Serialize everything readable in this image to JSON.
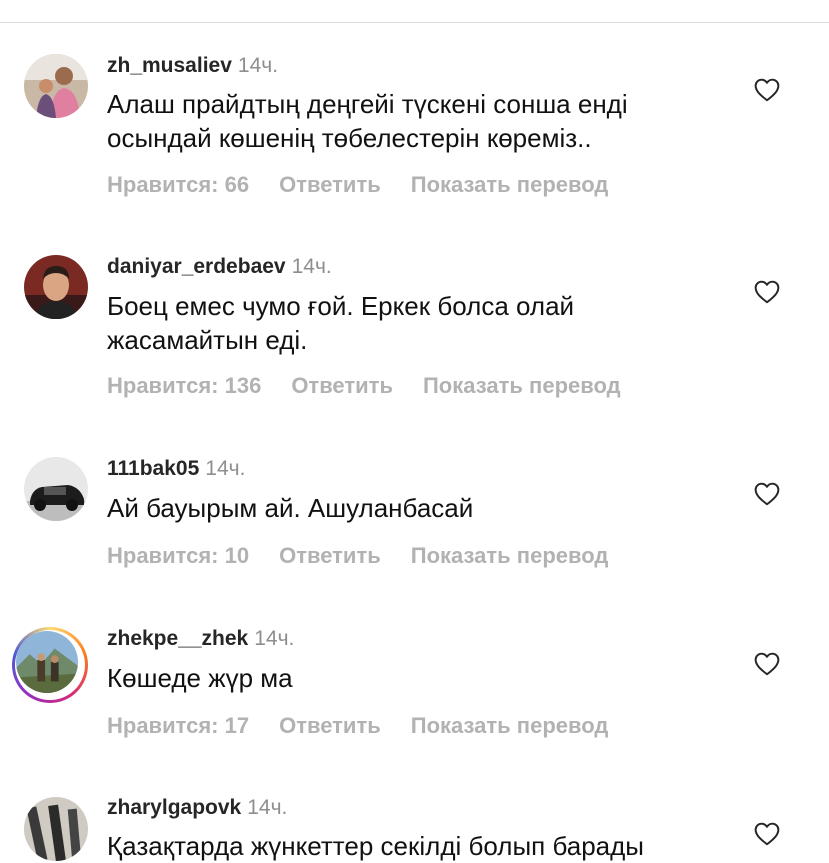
{
  "comments": [
    {
      "username": "zh_musaliev",
      "time": "14ч.",
      "text": "Алаш прайдтың деңгейі түскені сонша енді осындай көшенің төбелестерін көреміз..",
      "likes": "Нравится: 66",
      "reply": "Ответить",
      "translate": "Показать перевод",
      "avatar": "person-with-child-photo"
    },
    {
      "username": "daniyar_erdebaev",
      "time": "14ч.",
      "text": "Боец емес чумо ғой.  Еркек болса олай жасамайтын еді.",
      "likes": "Нравится: 136",
      "reply": "Ответить",
      "translate": "Показать перевод",
      "avatar": "man-portrait-photo"
    },
    {
      "username": "111bak05",
      "time": "14ч.",
      "text": "Ай бауырым ай. Ашуланбасай",
      "likes": "Нравится: 10",
      "reply": "Ответить",
      "translate": "Показать перевод",
      "avatar": "black-car-photo"
    },
    {
      "username": "zhekpe__zhek",
      "time": "14ч.",
      "text": "Көшеде жүр ма",
      "likes": "Нравится: 17",
      "reply": "Ответить",
      "translate": "Показать перевод",
      "avatar": "mountain-people-photo"
    },
    {
      "username": "zharylgapovk",
      "time": "14ч.",
      "text": "Қазақтарда жүнкеттер секілді болып барады",
      "avatar": "rifles-photo"
    }
  ]
}
